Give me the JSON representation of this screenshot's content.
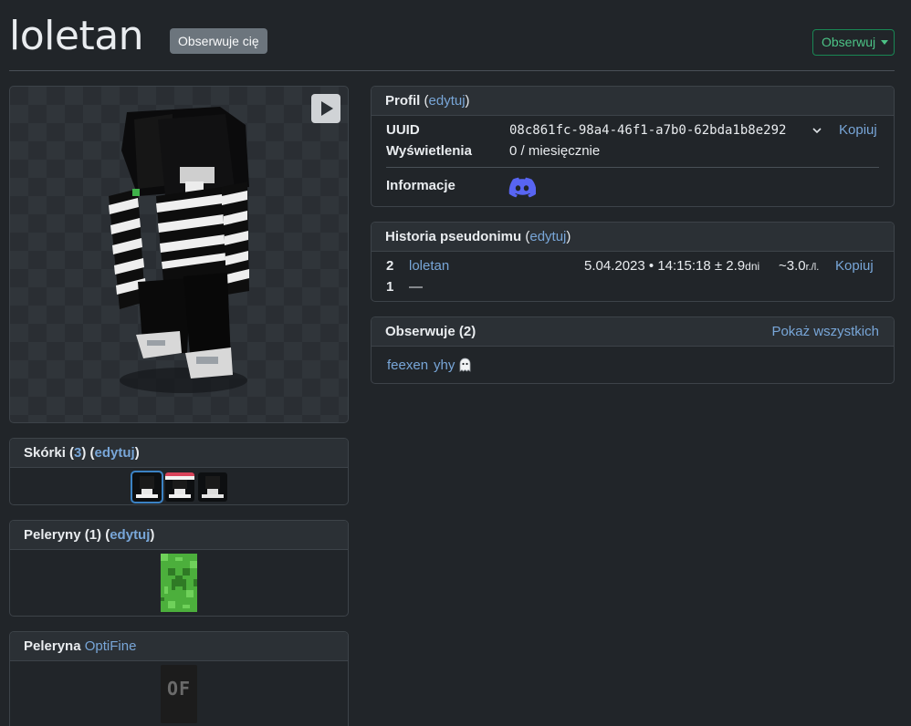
{
  "header": {
    "username": "loletan",
    "follows_you_badge": "Obserwuje cię",
    "follow_button": "Obserwuj"
  },
  "profile": {
    "title": "Profil",
    "edit": "edytuj",
    "uuid_label": "UUID",
    "uuid_value": "08c861fc-98a4-46f1-a7b0-62bda1b8e292",
    "copy": "Kopiuj",
    "views_label": "Wyświetlenia",
    "views_value": "0 / miesięcznie",
    "info_label": "Informacje",
    "info_icon": "discord-icon"
  },
  "history": {
    "title": "Historia pseudonimu",
    "edit": "edytuj",
    "rows": [
      {
        "num": "2",
        "name": "loletan",
        "date": "5.04.2023 • 14:15:18 ± 2.9",
        "date_unit": "dni",
        "age": "~3.0",
        "age_unit": "r./l.",
        "copy": "Kopiuj"
      },
      {
        "num": "1",
        "name": "—"
      }
    ]
  },
  "observes": {
    "title": "Obserwuje (2)",
    "show_all": "Pokaż wszystkich",
    "users": [
      "feexen",
      "yhy"
    ]
  },
  "skins": {
    "title_prefix": "Skórki (",
    "count": "3",
    "title_mid": ") (",
    "edit": "edytuj",
    "title_suffix": ")"
  },
  "capes": {
    "title_prefix": "Peleryny (1) (",
    "edit": "edytuj",
    "title_suffix": ")"
  },
  "optifine": {
    "title_prefix": "Peleryna ",
    "link": "OptiFine",
    "cape_text": "OF"
  },
  "colors": {
    "background": "#212529",
    "card_header": "#2b3035",
    "link": "#78a6d8",
    "follow_green": "#198754",
    "badge_gray": "#6c757d",
    "discord": "#5865f2"
  }
}
